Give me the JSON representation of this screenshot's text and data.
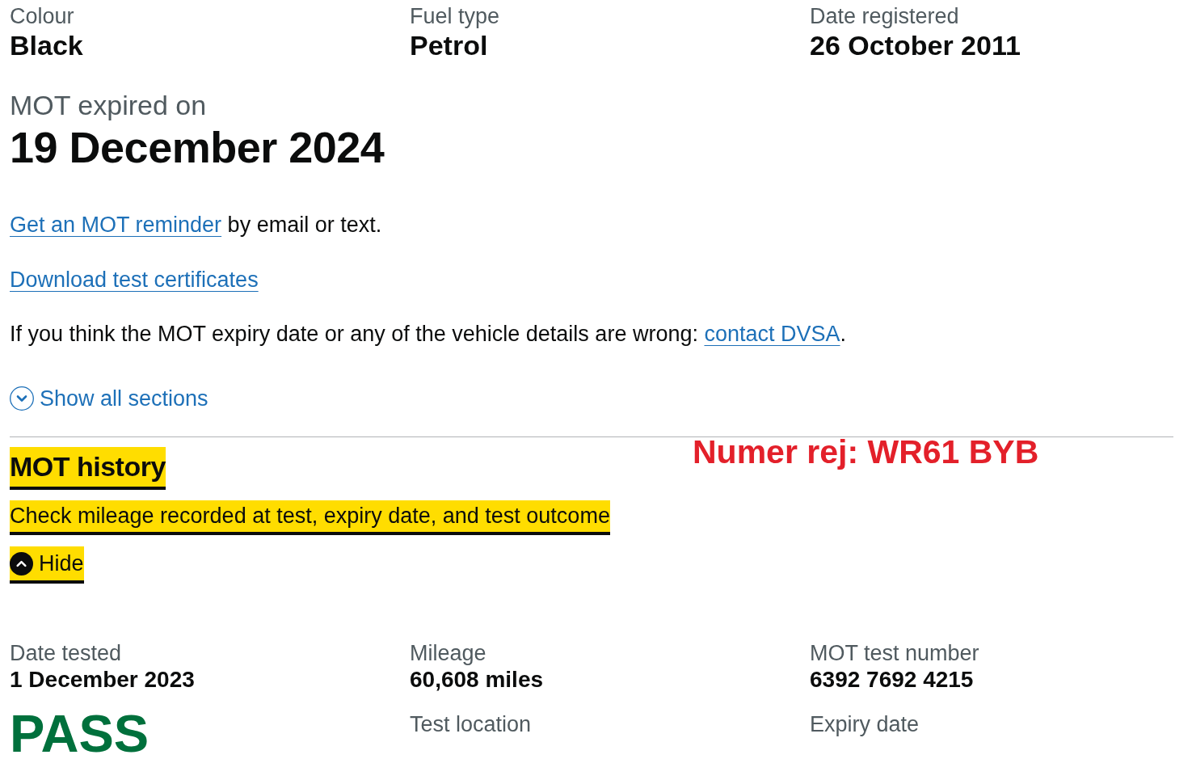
{
  "vehicle_details": [
    {
      "label": "Colour",
      "value": "Black"
    },
    {
      "label": "Fuel type",
      "value": "Petrol"
    },
    {
      "label": "Date registered",
      "value": "26 October 2011"
    }
  ],
  "mot_status": {
    "label": "MOT expired on",
    "value": "19 December 2024"
  },
  "reminder": {
    "link": "Get an MOT reminder",
    "text": "by email or text."
  },
  "download_link": "Download test certificates",
  "contact_note": {
    "text": "If you think the MOT expiry date or any of the vehicle details are wrong:",
    "link": "contact DVSA",
    "end": "."
  },
  "show_all": {
    "label": "Show all sections"
  },
  "annotation": "Numer rej: WR61 BYB",
  "section": {
    "title": "MOT history",
    "summary": "Check mileage recorded at test, expiry date, and test outcome",
    "toggle": "Hide",
    "expanded": true,
    "focused": true
  },
  "test_record": {
    "columns": [
      {
        "items": [
          {
            "kind": "field",
            "label": "Date tested",
            "value": "1 December 2023"
          },
          {
            "kind": "pass",
            "text": "PASS"
          }
        ]
      },
      {
        "items": [
          {
            "kind": "field",
            "label": "Mileage",
            "value": "60,608 miles"
          },
          {
            "kind": "field",
            "label": "Test location"
          }
        ]
      },
      {
        "items": [
          {
            "kind": "field",
            "label": "MOT test number",
            "value": "6392 7692 4215"
          },
          {
            "kind": "field",
            "label": "Expiry date"
          }
        ]
      }
    ]
  }
}
